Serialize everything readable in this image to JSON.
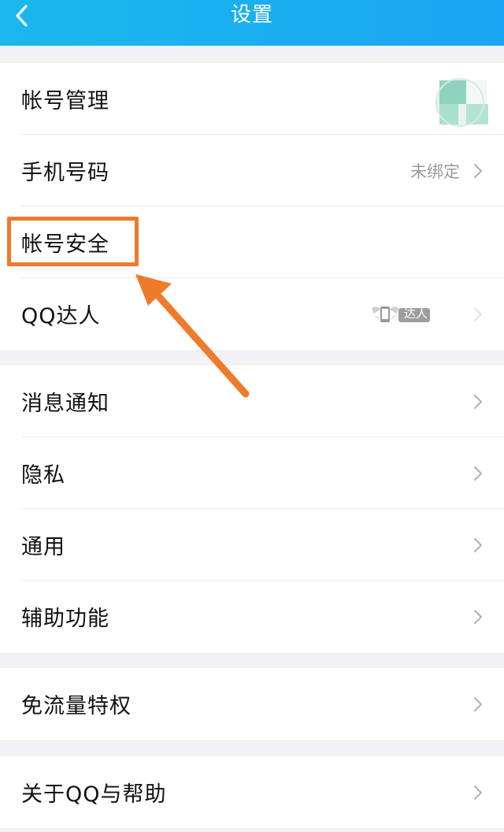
{
  "header": {
    "title": "设置"
  },
  "groups": [
    {
      "items": [
        {
          "label": "帐号管理"
        },
        {
          "label": "手机号码",
          "value": "未绑定"
        },
        {
          "label": "帐号安全"
        },
        {
          "label": "QQ达人",
          "badge_text": "达人"
        }
      ]
    },
    {
      "items": [
        {
          "label": "消息通知"
        },
        {
          "label": "隐私"
        },
        {
          "label": "通用"
        },
        {
          "label": "辅助功能"
        }
      ]
    },
    {
      "items": [
        {
          "label": "免流量特权"
        }
      ]
    },
    {
      "items": [
        {
          "label": "关于QQ与帮助"
        }
      ]
    }
  ],
  "colors": {
    "header": "#1aa6f2",
    "highlight": "#f07a2b",
    "background": "#f2f2f6"
  }
}
